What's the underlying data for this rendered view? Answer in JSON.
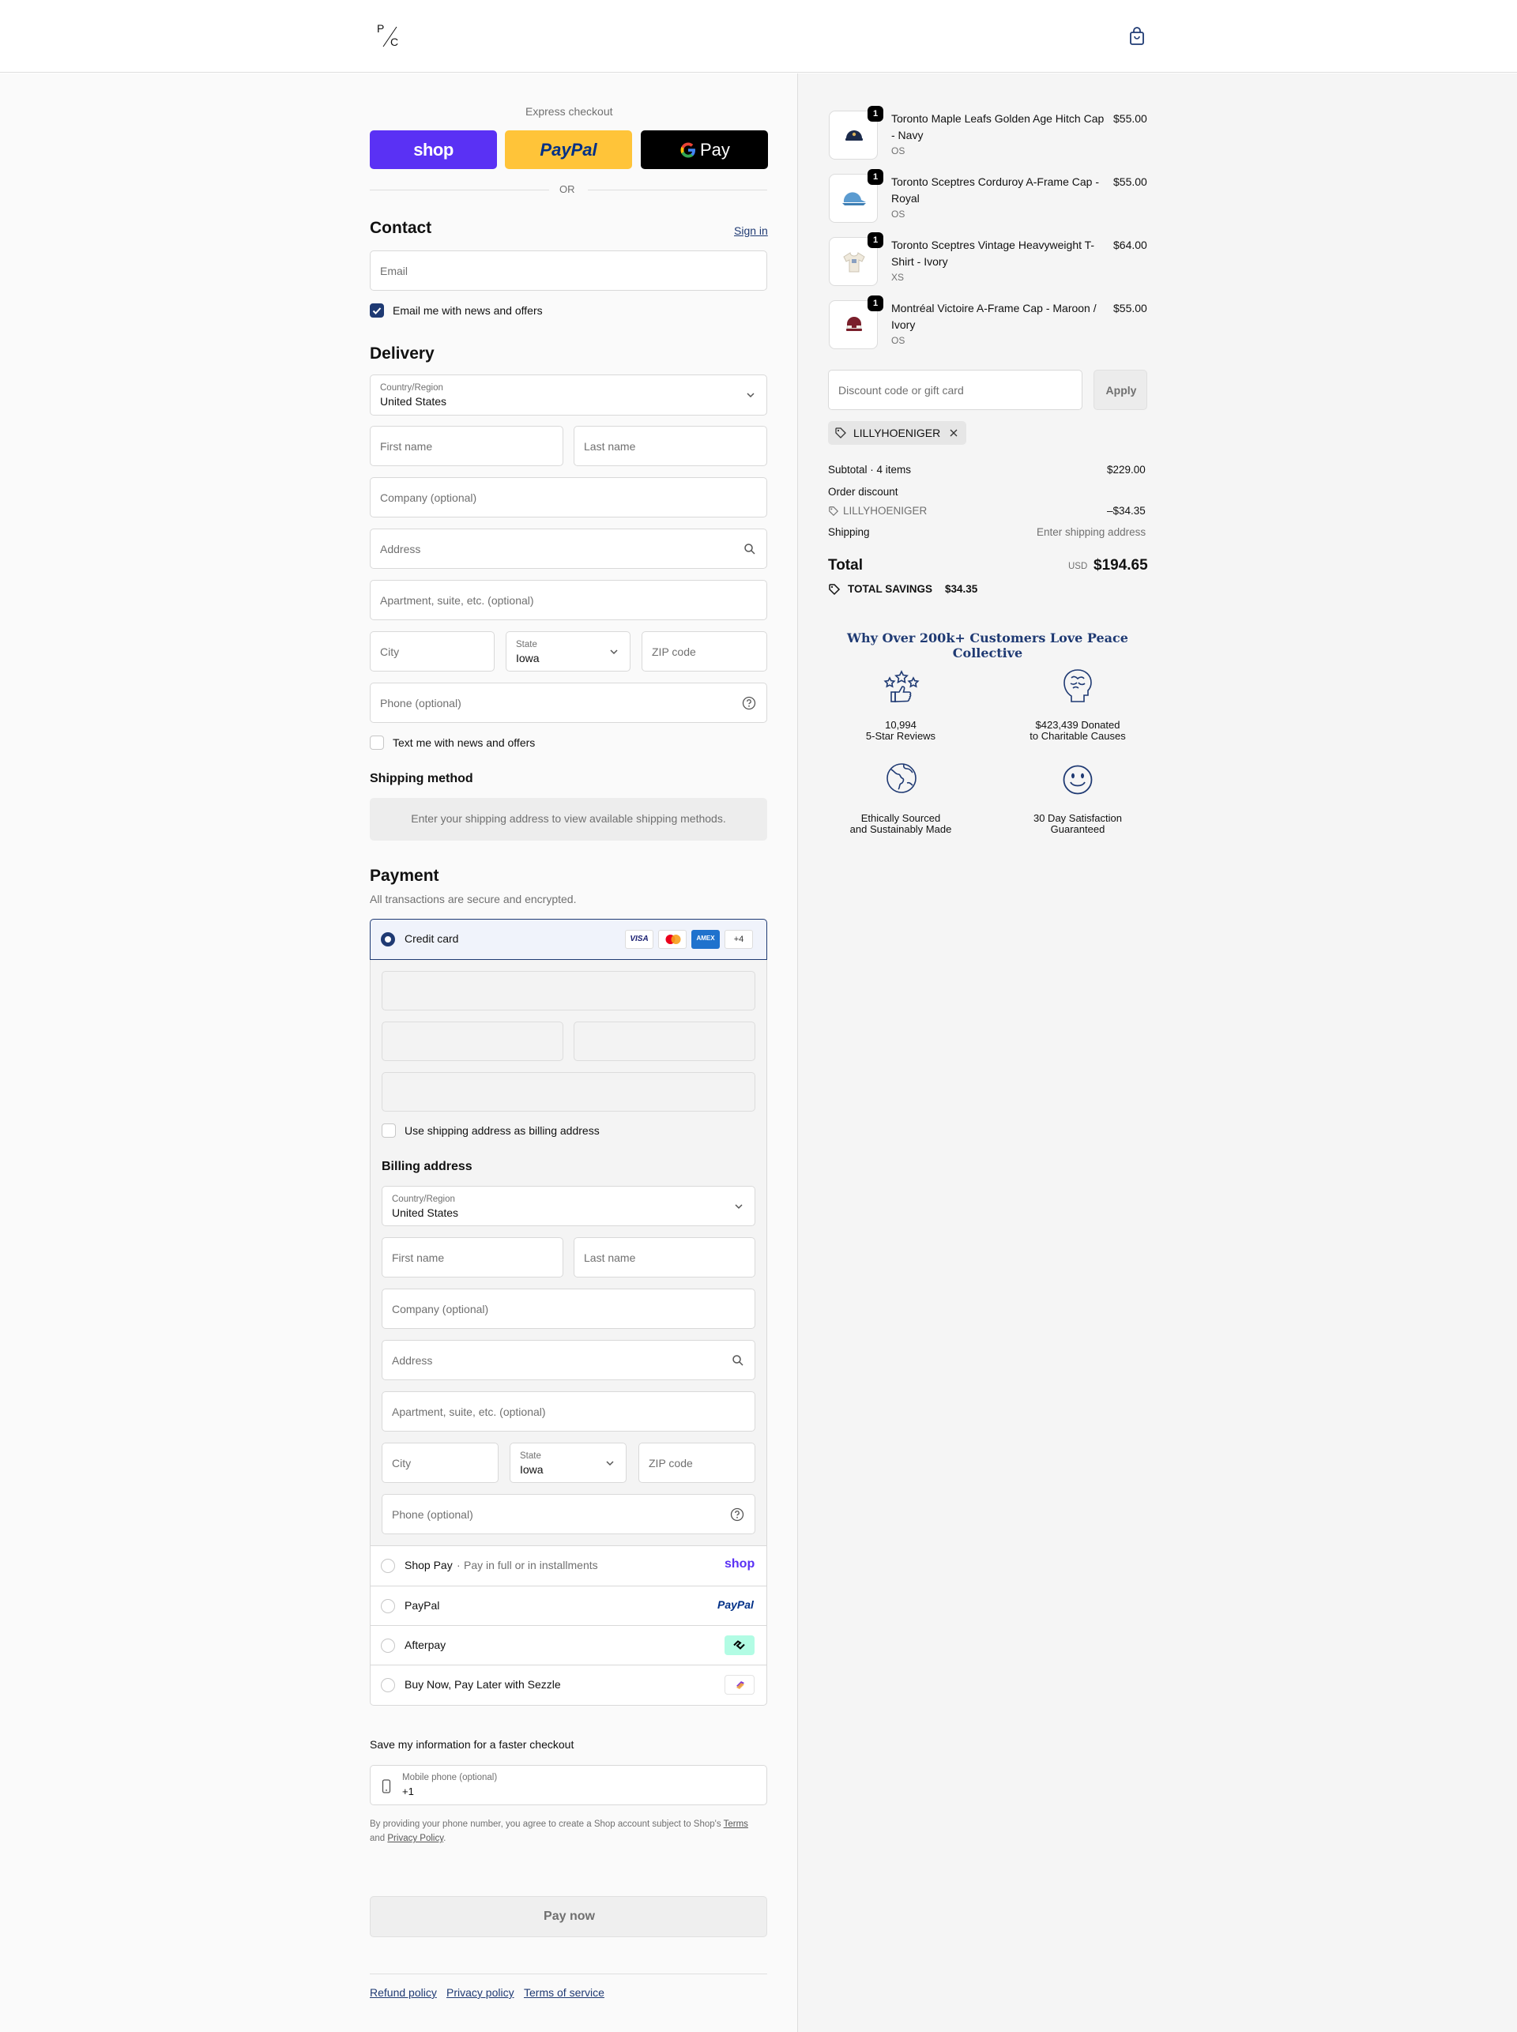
{
  "header": {
    "logo_top": "P",
    "logo_bottom": "C"
  },
  "express": {
    "title": "Express checkout",
    "shop_label": "shop",
    "paypal_label": "PayPal",
    "gpay_label": "Pay",
    "or_label": "OR",
    "colors": {
      "shop": "#5a31f4",
      "paypal": "#ffc439",
      "gpay": "#000000"
    }
  },
  "contact": {
    "title": "Contact",
    "sign_in": "Sign in",
    "email_placeholder": "Email",
    "news_label": "Email me with news and offers",
    "news_checked": true
  },
  "delivery": {
    "title": "Delivery",
    "country_label": "Country/Region",
    "country_value": "United States",
    "first_name": "First name",
    "last_name": "Last name",
    "company": "Company (optional)",
    "address": "Address",
    "apartment": "Apartment, suite, etc. (optional)",
    "city": "City",
    "state_label": "State",
    "state_value": "Iowa",
    "zip": "ZIP code",
    "phone": "Phone (optional)",
    "sms_label": "Text me with news and offers"
  },
  "shipping_method": {
    "title": "Shipping method",
    "message": "Enter your shipping address to view available shipping methods."
  },
  "payment": {
    "title": "Payment",
    "subtitle": "All transactions are secure and encrypted.",
    "credit_card_label": "Credit card",
    "card_brands": [
      "VISA",
      "mastercard",
      "AMEX",
      "+4"
    ],
    "billing_same_label": "Use shipping address as billing address",
    "billing_title": "Billing address",
    "methods": [
      {
        "name": "Shop Pay",
        "note": "Pay in full or in installments",
        "logo": "shop"
      },
      {
        "name": "PayPal",
        "note": "",
        "logo": "PayPal"
      },
      {
        "name": "Afterpay",
        "note": "",
        "logo": "afterpay"
      },
      {
        "name": "Buy Now, Pay Later with Sezzle",
        "note": "",
        "logo": "sezzle"
      }
    ]
  },
  "save_info": {
    "title": "Save my information for a faster checkout",
    "mobile_label": "Mobile phone (optional)",
    "mobile_value": "+1",
    "legal_1": "By providing your phone number, you agree to create a Shop account subject to Shop's",
    "legal_terms": "Terms",
    "legal_and": "and",
    "legal_privacy": "Privacy Policy",
    "legal_end": "."
  },
  "pay_now": "Pay now",
  "footer_links": [
    "Refund policy",
    "Privacy policy",
    "Terms of service"
  ],
  "cart": {
    "items": [
      {
        "qty": "1",
        "name_1": "Toronto Maple Leafs Golden Age Hitch Cap",
        "name_2": "- Navy",
        "variant": "OS",
        "price": "$55.00"
      },
      {
        "qty": "1",
        "name_1": "Toronto Sceptres Corduroy A-Frame Cap -",
        "name_2": "Royal",
        "variant": "OS",
        "price": "$55.00"
      },
      {
        "qty": "1",
        "name_1": "Toronto Sceptres Vintage Heavyweight T-",
        "name_2": "Shirt - Ivory",
        "variant": "XS",
        "price": "$64.00"
      },
      {
        "qty": "1",
        "name_1": "Montréal Victoire A-Frame Cap - Maroon /",
        "name_2": "Ivory",
        "variant": "OS",
        "price": "$55.00"
      }
    ],
    "discount_placeholder": "Discount code or gift card",
    "apply_label": "Apply",
    "applied_code": "LILLYHOENIGER",
    "subtotal_label": "Subtotal · 4 items",
    "subtotal_value": "$229.00",
    "order_discount_label": "Order discount",
    "discount_code": "LILLYHOENIGER",
    "discount_value": "–$34.35",
    "shipping_label": "Shipping",
    "shipping_value": "Enter shipping address",
    "total_label": "Total",
    "total_currency": "USD",
    "total_value": "$194.65",
    "savings_label": "TOTAL SAVINGS",
    "savings_value": "$34.35"
  },
  "benefits": {
    "title": "Why Over 200k+ Customers Love Peace Collective",
    "items": [
      {
        "line1": "10,994",
        "line2": "5-Star Reviews",
        "icon": "stars-thumb-icon"
      },
      {
        "line1": "$423,439 Donated",
        "line2": "to Charitable Causes",
        "icon": "brain-icon"
      },
      {
        "line1": "Ethically Sourced",
        "line2": "and Sustainably Made",
        "icon": "globe-icon"
      },
      {
        "line1": "30 Day Satisfaction",
        "line2": "Guaranteed",
        "icon": "smiley-icon"
      }
    ]
  }
}
